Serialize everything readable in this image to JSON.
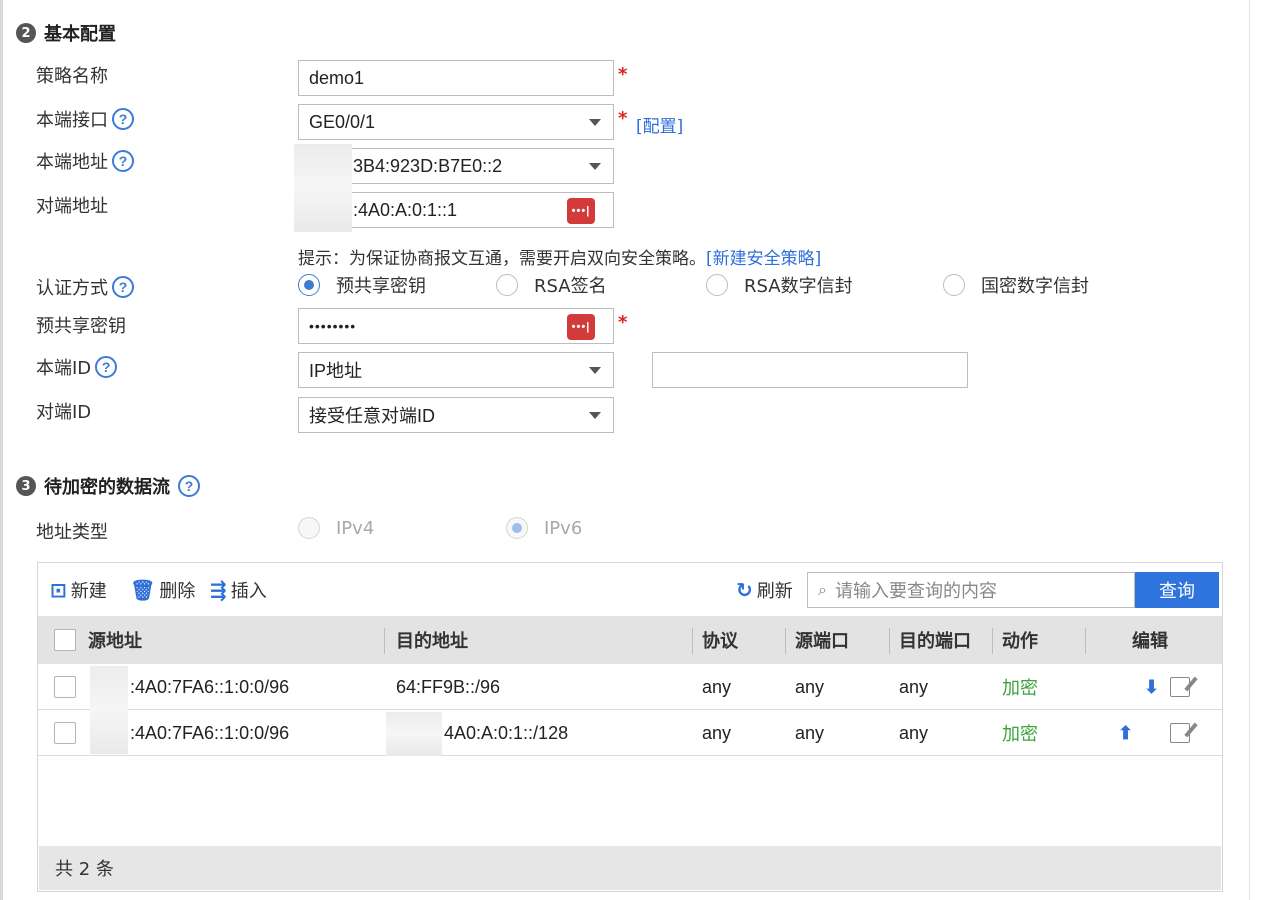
{
  "section2": {
    "number": "2",
    "title": "基本配置"
  },
  "fields": {
    "policy_name": {
      "label": "策略名称",
      "value": "demo1"
    },
    "local_interface": {
      "label": "本端接口",
      "value": "GE0/0/1",
      "config_link": "[配置]"
    },
    "local_address": {
      "label": "本端地址",
      "value": "::3B4:923D:B7E0::2"
    },
    "peer_address": {
      "label": "对端地址",
      "value": ":4A0:A:0:1::1"
    },
    "hint": {
      "text": "提示：为保证协商报文互通，需要开启双向安全策略。",
      "link": "[新建安全策略]"
    },
    "auth_method": {
      "label": "认证方式",
      "options": [
        "预共享密钥",
        "RSA签名",
        "RSA数字信封",
        "国密数字信封"
      ],
      "selected": "预共享密钥"
    },
    "psk": {
      "label": "预共享密钥",
      "value": "••••••••"
    },
    "local_id": {
      "label": "本端ID",
      "value": "IP地址",
      "extra_value": ""
    },
    "peer_id": {
      "label": "对端ID",
      "value": "接受任意对端ID"
    }
  },
  "required_mark": "*",
  "password_toggle": "•••|",
  "section3": {
    "number": "3",
    "title": "待加密的数据流"
  },
  "address_type": {
    "label": "地址类型",
    "options": [
      "IPv4",
      "IPv6"
    ],
    "selected": "IPv6"
  },
  "toolbar": {
    "new": "新建",
    "delete": "删除",
    "insert": "插入",
    "refresh": "刷新",
    "search_placeholder": "请输入要查询的内容",
    "search_button": "查询"
  },
  "table": {
    "headers": [
      "源地址",
      "目的地址",
      "协议",
      "源端口",
      "目的端口",
      "动作",
      "编辑"
    ],
    "rows": [
      {
        "src": ":4A0:7FA6::1:0:0/96",
        "dst": "64:FF9B::/96",
        "protocol": "any",
        "src_port": "any",
        "dst_port": "any",
        "action": "加密"
      },
      {
        "src": ":4A0:7FA6::1:0:0/96",
        "dst": "4A0:A:0:1::/128",
        "protocol": "any",
        "src_port": "any",
        "dst_port": "any",
        "action": "加密"
      }
    ],
    "footer": "共 2 条"
  },
  "colors": {
    "accent": "#2f73dc",
    "required": "#e02020",
    "action_green": "#3aa33a"
  }
}
